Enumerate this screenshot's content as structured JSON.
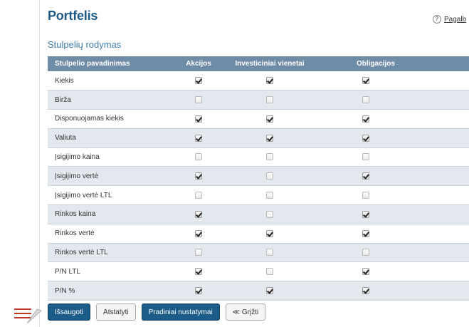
{
  "page": {
    "title": "Portfelis",
    "help_label": "Pagalb",
    "subtitle": "Stulpelių rodymas"
  },
  "table": {
    "headers": [
      "Stulpelio pavadinimas",
      "Akcijos",
      "Investiciniai vienetai",
      "Obligacijos"
    ],
    "rows": [
      {
        "name": "Kiekis",
        "checks": [
          true,
          true,
          true
        ]
      },
      {
        "name": "Birža",
        "checks": [
          false,
          false,
          false
        ]
      },
      {
        "name": "Disponuojamas kiekis",
        "checks": [
          true,
          true,
          true
        ]
      },
      {
        "name": "Valiuta",
        "checks": [
          true,
          true,
          true
        ]
      },
      {
        "name": "Įsigijimo kaina",
        "checks": [
          false,
          false,
          false
        ]
      },
      {
        "name": "Įsigijimo vertė",
        "checks": [
          true,
          false,
          true
        ]
      },
      {
        "name": "Įsigijimo vertė LTL",
        "checks": [
          false,
          false,
          false
        ]
      },
      {
        "name": "Rinkos kaina",
        "checks": [
          true,
          false,
          true
        ]
      },
      {
        "name": "Rinkos vertė",
        "checks": [
          true,
          true,
          true
        ]
      },
      {
        "name": "Rinkos vertė LTL",
        "checks": [
          false,
          false,
          false
        ]
      },
      {
        "name": "P/N LTL",
        "checks": [
          true,
          false,
          true
        ]
      },
      {
        "name": "P/N %",
        "checks": [
          true,
          true,
          true
        ]
      }
    ]
  },
  "actions": {
    "save": "Išsaugoti",
    "reset": "Atstatyti",
    "defaults": "Pradiniai nustatymai",
    "back": "≪ Grįžti"
  },
  "colors": {
    "header_bg": "#6f8ca6",
    "row_alt_bg": "#e2e8ee",
    "primary_button": "#1c5c89",
    "title": "#1d5a86",
    "pointer": "#c0392b"
  }
}
